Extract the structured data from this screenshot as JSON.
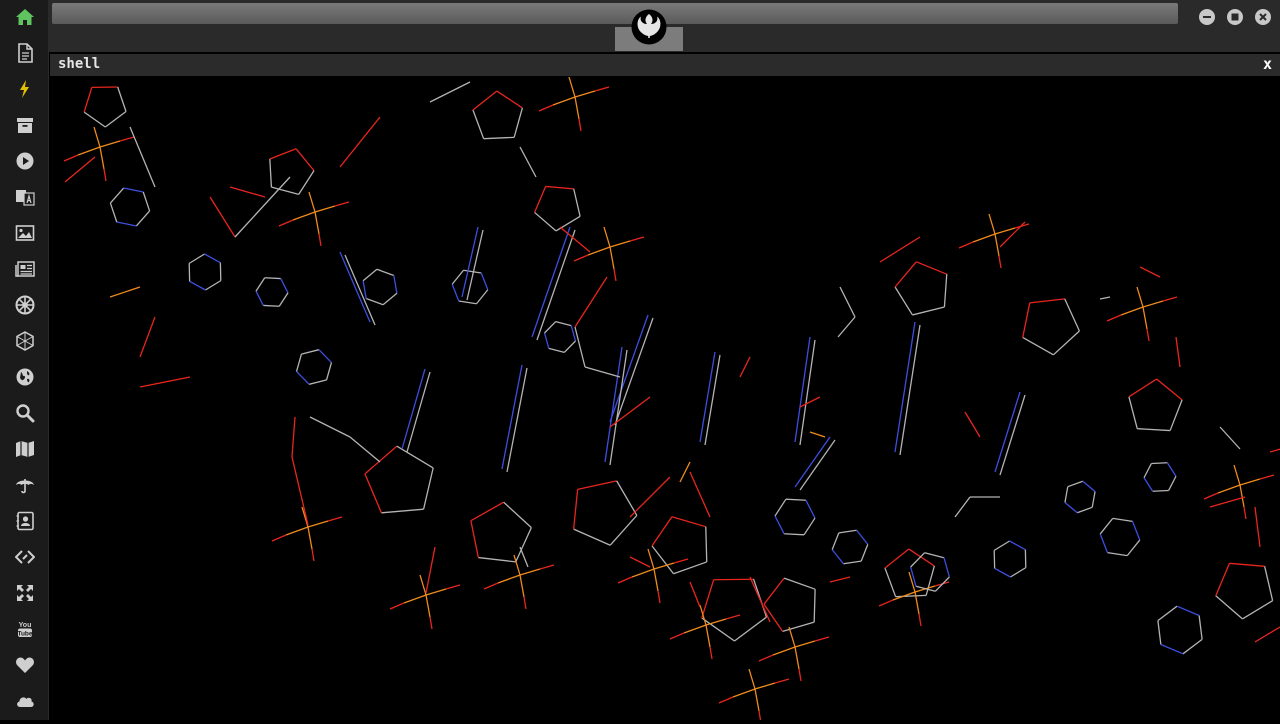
{
  "sidebar": {
    "items": [
      {
        "icon": "home-icon",
        "color": "#5fc35f"
      },
      {
        "icon": "document-icon"
      },
      {
        "icon": "lightning-icon"
      },
      {
        "icon": "archive-icon"
      },
      {
        "icon": "play-icon"
      },
      {
        "icon": "translate-icon"
      },
      {
        "icon": "image-icon"
      },
      {
        "icon": "newspaper-icon"
      },
      {
        "icon": "empire-icon"
      },
      {
        "icon": "hexagon-icon"
      },
      {
        "icon": "globe-icon"
      },
      {
        "icon": "search-icon"
      },
      {
        "icon": "map-icon"
      },
      {
        "icon": "umbrella-icon"
      },
      {
        "icon": "contact-card-icon"
      },
      {
        "icon": "code-icon"
      },
      {
        "icon": "expand-icon"
      },
      {
        "icon": "youtube-icon"
      },
      {
        "icon": "heart-icon"
      },
      {
        "icon": "cloud-icon"
      }
    ]
  },
  "window": {
    "logo_icon": "rebel-alliance-icon",
    "controls": [
      "minimize-icon",
      "maximize-icon",
      "close-icon"
    ]
  },
  "shell": {
    "title": "shell",
    "close_label": "x"
  },
  "viewer": {
    "content": "molecule-wireframe",
    "colors": {
      "carbon": "#b4b4b4",
      "oxygen": "#e8261e",
      "nitrogen": "#3c4fe0",
      "phosphorus": "#f08c1c"
    }
  }
}
